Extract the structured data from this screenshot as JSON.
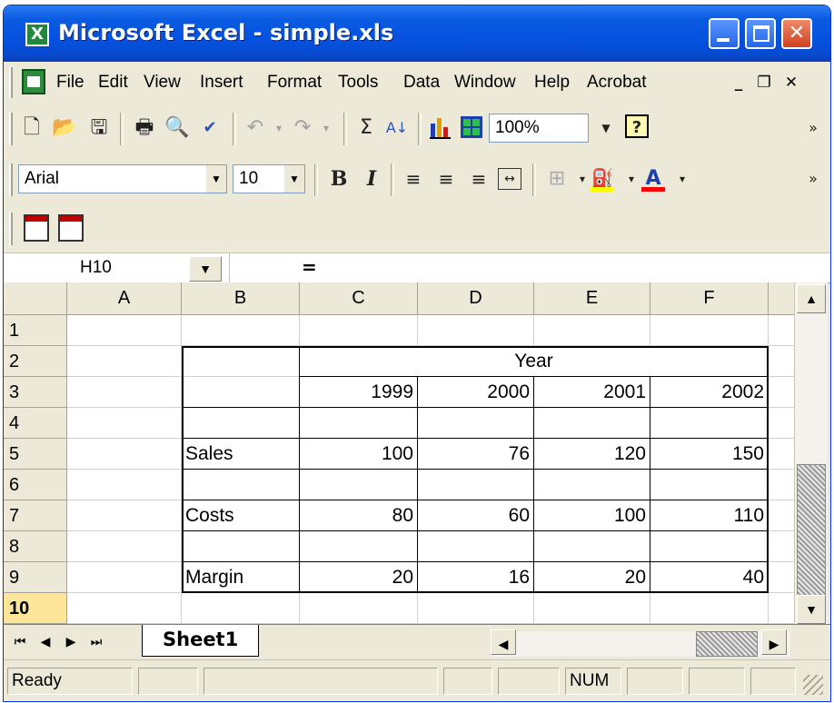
{
  "window": {
    "title": "Microsoft Excel - simple.xls",
    "app_icon": "excel-icon"
  },
  "menubar": {
    "items": [
      "File",
      "Edit",
      "View",
      "Insert",
      "Format",
      "Tools",
      "Data",
      "Window",
      "Help",
      "Acrobat"
    ]
  },
  "toolbar_standard": {
    "zoom": "100%"
  },
  "toolbar_formatting": {
    "font": "Arial",
    "size": "10",
    "bold": "B",
    "italic": "I",
    "colors": {
      "highlight": "#ffff00",
      "font": "#ff0000"
    }
  },
  "formula_bar": {
    "name_box": "H10",
    "equals": "=",
    "formula": ""
  },
  "grid": {
    "columns": [
      "A",
      "B",
      "C",
      "D",
      "E",
      "F"
    ],
    "rows": [
      "1",
      "2",
      "3",
      "4",
      "5",
      "6",
      "7",
      "8",
      "9",
      "10"
    ],
    "cells": {
      "C2": "Year",
      "C3": "1999",
      "D3": "2000",
      "E3": "2001",
      "F3": "2002",
      "B5": "Sales",
      "C5": "100",
      "D5": "76",
      "E5": "120",
      "F5": "150",
      "B7": "Costs",
      "C7": "80",
      "D7": "60",
      "E7": "100",
      "F7": "110",
      "B9": "Margin",
      "C9": "20",
      "D9": "16",
      "E9": "20",
      "F9": "40"
    },
    "active_cell": "H10"
  },
  "sheets": {
    "tabs": [
      "Sheet1"
    ],
    "active": "Sheet1"
  },
  "statusbar": {
    "status": "Ready",
    "num": "NUM"
  }
}
